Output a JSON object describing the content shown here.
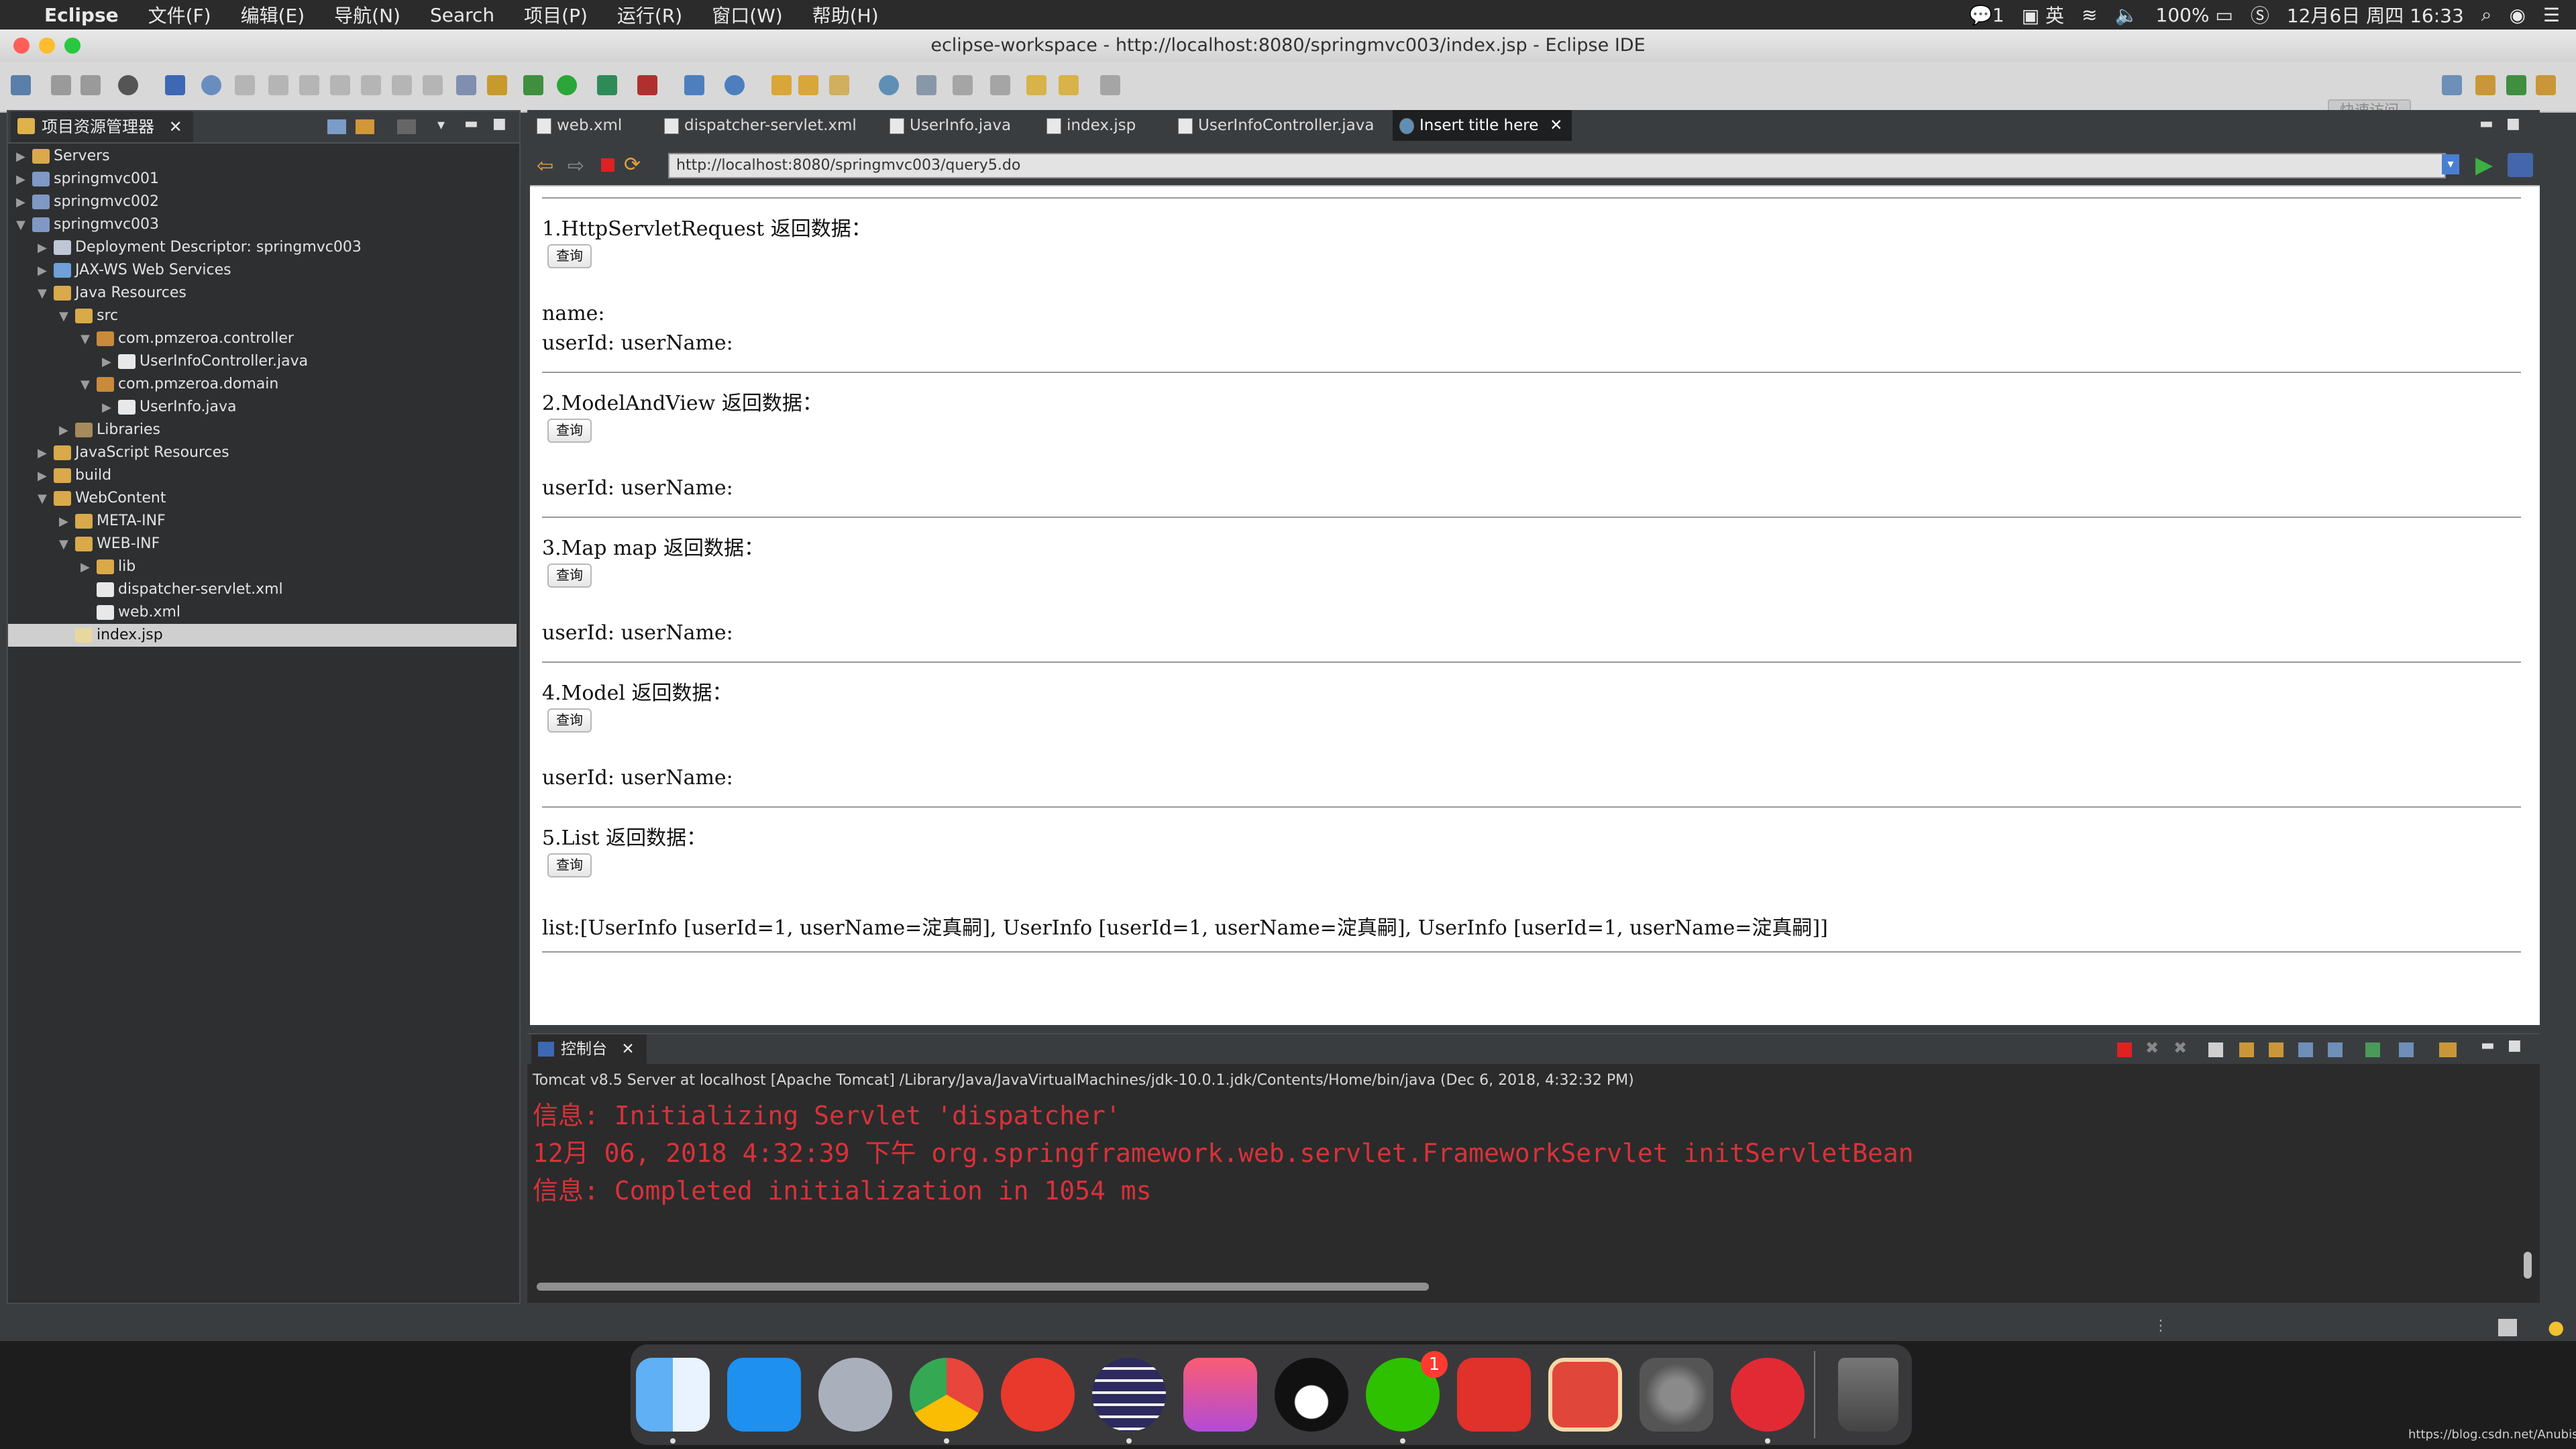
{
  "menubar": {
    "apple": "",
    "app_name": "Eclipse",
    "items": [
      "文件(F)",
      "编辑(E)",
      "导航(N)",
      "Search",
      "项目(P)",
      "运行(R)",
      "窗口(W)",
      "帮助(H)"
    ],
    "wechat_count": "1",
    "input_method": "英",
    "battery": "100%",
    "datetime": "12月6日 周四 16:33"
  },
  "window": {
    "title": "eclipse-workspace - http://localhost:8080/springmvc003/index.jsp - Eclipse IDE",
    "quick_access": "快速访问"
  },
  "explorer": {
    "tab_title": "项目资源管理器",
    "tree": [
      {
        "label": "Servers",
        "arrow": "▶"
      },
      {
        "label": "springmvc001",
        "arrow": "▶"
      },
      {
        "label": "springmvc002",
        "arrow": "▶"
      },
      {
        "label": "springmvc003",
        "arrow": "▼"
      },
      {
        "label": "Deployment Descriptor: springmvc003",
        "arrow": "▶"
      },
      {
        "label": "JAX-WS Web Services",
        "arrow": "▶"
      },
      {
        "label": "Java Resources",
        "arrow": "▼"
      },
      {
        "label": "src",
        "arrow": "▼"
      },
      {
        "label": "com.pmzeroa.controller",
        "arrow": "▼"
      },
      {
        "label": "UserInfoController.java",
        "arrow": "▶"
      },
      {
        "label": "com.pmzeroa.domain",
        "arrow": "▼"
      },
      {
        "label": "UserInfo.java",
        "arrow": "▶"
      },
      {
        "label": "Libraries",
        "arrow": "▶"
      },
      {
        "label": "JavaScript Resources",
        "arrow": "▶"
      },
      {
        "label": "build",
        "arrow": "▶"
      },
      {
        "label": "WebContent",
        "arrow": "▼"
      },
      {
        "label": "META-INF",
        "arrow": "▶"
      },
      {
        "label": "WEB-INF",
        "arrow": "▼"
      },
      {
        "label": "lib",
        "arrow": "▶"
      },
      {
        "label": "dispatcher-servlet.xml",
        "arrow": ""
      },
      {
        "label": "web.xml",
        "arrow": ""
      },
      {
        "label": "index.jsp",
        "arrow": ""
      }
    ]
  },
  "editor": {
    "tabs": [
      "web.xml",
      "dispatcher-servlet.xml",
      "UserInfo.java",
      "index.jsp",
      "UserInfoController.java",
      "Insert title here"
    ],
    "url": "http://localhost:8080/springmvc003/query5.do"
  },
  "page": {
    "button_label": "查询",
    "sections": [
      {
        "heading": "1.HttpServletRequest 返回数据：",
        "lines": [
          "name:",
          "userId: userName:"
        ]
      },
      {
        "heading": "2.ModelAndView 返回数据：",
        "lines": [
          "userId: userName:"
        ]
      },
      {
        "heading": "3.Map map 返回数据：",
        "lines": [
          "userId: userName:"
        ]
      },
      {
        "heading": "4.Model 返回数据：",
        "lines": [
          "userId: userName:"
        ]
      },
      {
        "heading": "5.List 返回数据：",
        "lines": [
          "list:[UserInfo [userId=1, userName=淀真嗣], UserInfo [userId=1, userName=淀真嗣], UserInfo [userId=1, userName=淀真嗣]]"
        ]
      }
    ]
  },
  "console": {
    "tab_title": "控制台",
    "description": "Tomcat v8.5 Server at localhost [Apache Tomcat] /Library/Java/JavaVirtualMachines/jdk-10.0.1.jdk/Contents/Home/bin/java  (Dec 6, 2018, 4:32:32 PM)",
    "lines": [
      "信息: Initializing Servlet 'dispatcher'",
      "12月 06, 2018 4:32:39 下午 org.springframework.web.servlet.FrameworkServlet initServletBean",
      "信息: Completed initialization in 1054 ms"
    ]
  },
  "dock": {
    "wechat_badge": "1"
  },
  "watermark": "https://blog.csdn.net/AnubisZero"
}
